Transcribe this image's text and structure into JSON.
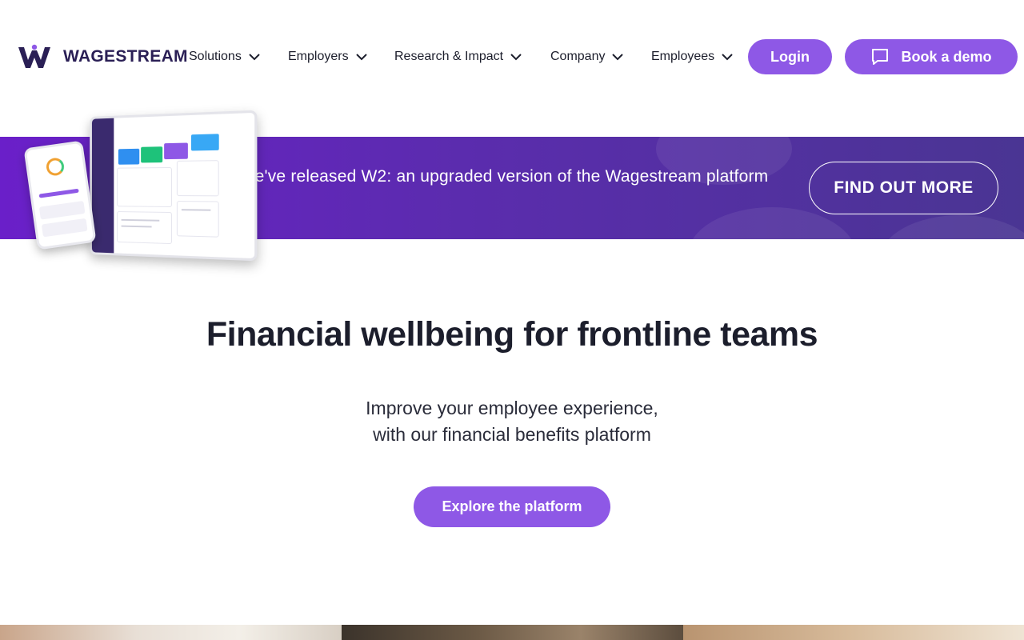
{
  "brand": {
    "name": "WAGESTREAM",
    "logo_icon": "wagestream-w-logo",
    "accent_color": "#8e58e6",
    "dark_color": "#2a1f55"
  },
  "nav": {
    "items": [
      {
        "label": "Solutions"
      },
      {
        "label": "Employers"
      },
      {
        "label": "Research & Impact"
      },
      {
        "label": "Company"
      },
      {
        "label": "Employees"
      }
    ],
    "login_label": "Login",
    "demo_label": "Book a demo",
    "demo_icon": "chat-bubble-icon"
  },
  "banner": {
    "text": "We've released W2: an upgraded version of the Wagestream platform",
    "button_label": "FIND OUT MORE",
    "gradient_start": "#6a1fc9",
    "gradient_end": "#4a3593"
  },
  "hero": {
    "title": "Financial wellbeing for frontline teams",
    "subtitle_line1": "Improve your employee experience,",
    "subtitle_line2": "with our financial benefits platform",
    "cta_label": "Explore the platform"
  }
}
